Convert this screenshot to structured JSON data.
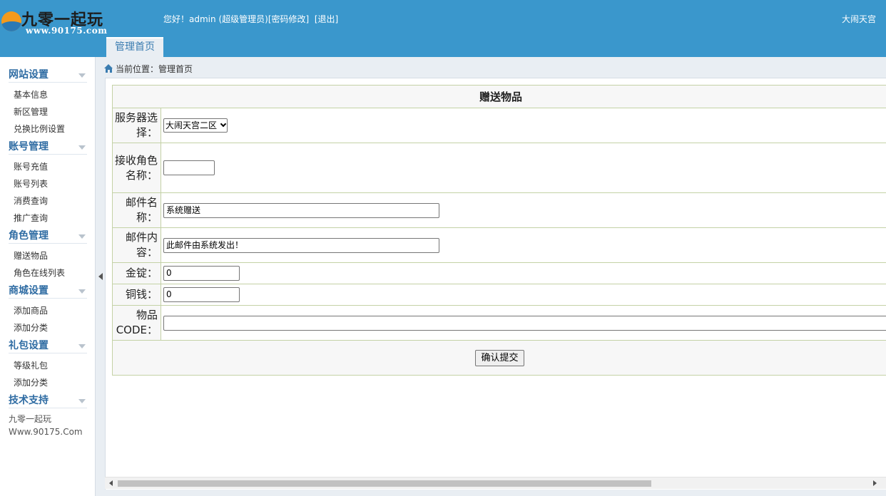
{
  "header": {
    "logo_text": "九零一起玩",
    "logo_url": "www.90175.com",
    "greeting_prefix": "您好！",
    "username": "admin",
    "role": "(超级管理员)",
    "change_password": "[密码修改]",
    "logout": "[退出]",
    "server_name": "大闹天宫",
    "nav_tab": "管理首页"
  },
  "sidebar": {
    "groups": [
      {
        "title": "网站设置",
        "items": [
          "基本信息",
          "新区管理",
          "兑换比例设置"
        ]
      },
      {
        "title": "账号管理",
        "items": [
          "账号充值",
          "账号列表",
          "消费查询",
          "推广查询"
        ]
      },
      {
        "title": "角色管理",
        "items": [
          "赠送物品",
          "角色在线列表"
        ]
      },
      {
        "title": "商城设置",
        "items": [
          "添加商品",
          "添加分类"
        ]
      },
      {
        "title": "礼包设置",
        "items": [
          "等级礼包",
          "添加分类"
        ]
      },
      {
        "title": "技术支持",
        "items": []
      }
    ],
    "footer_line1": "九零一起玩",
    "footer_line2": "Www.90175.Com"
  },
  "breadcrumb": {
    "label": "当前位置：",
    "current": "管理首页"
  },
  "form": {
    "title": "赠送物品",
    "server_label": "服务器选择：",
    "server_value": "大闹天宫二区",
    "role_label": "接收角色名称：",
    "role_value": "",
    "mail_name_label": "邮件名称：",
    "mail_name_value": "系统赠送",
    "mail_content_label": "邮件内容：",
    "mail_content_value": "此邮件由系统发出！",
    "gold_label": "金锭：",
    "gold_value": "0",
    "copper_label": "铜钱：",
    "copper_value": "0",
    "item_code_label": "物品CODE：",
    "item_code_value": "",
    "submit_label": "确认提交"
  },
  "colors": {
    "header_bg": "#3a97cc",
    "sidebar_title": "#2f6ca3",
    "table_border": "#c4d2a6"
  }
}
